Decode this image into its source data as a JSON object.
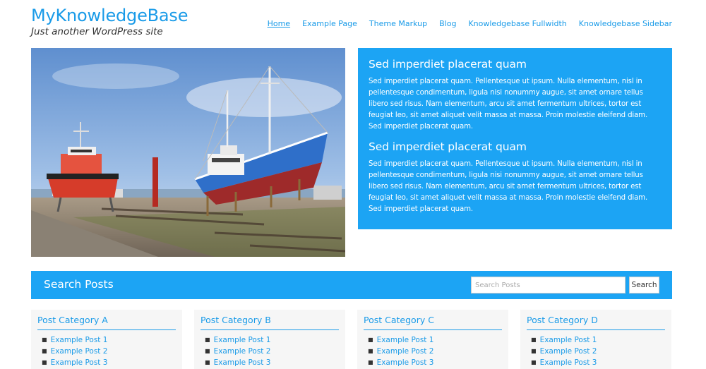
{
  "header": {
    "site_title": "MyKnowledgeBase",
    "tagline": "Just another WordPress site"
  },
  "nav": {
    "items": [
      {
        "label": "Home",
        "active": true
      },
      {
        "label": "Example Page"
      },
      {
        "label": "Theme Markup"
      },
      {
        "label": "Blog"
      },
      {
        "label": "Knowledgebase Fullwidth"
      },
      {
        "label": "Knowledgebase Sidebar"
      }
    ]
  },
  "hero": {
    "image_icon": "boats-photo"
  },
  "info": {
    "sections": [
      {
        "heading": "Sed imperdiet placerat quam",
        "body": "Sed imperdiet placerat quam. Pellentesque ut ipsum. Nulla elementum, nisl in pellentesque condimentum, ligula nisi nonummy augue, sit amet ornare tellus libero sed risus. Nam elementum, arcu sit amet fermentum ultrices, tortor est feugiat leo, sit amet aliquet velit massa at massa. Proin molestie eleifend diam. Sed imperdiet placerat quam."
      },
      {
        "heading": "Sed imperdiet placerat quam",
        "body": "Sed imperdiet placerat quam. Pellentesque ut ipsum. Nulla elementum, nisl in pellentesque condimentum, ligula nisi nonummy augue, sit amet ornare tellus libero sed risus. Nam elementum, arcu sit amet fermentum ultrices, tortor est feugiat leo, sit amet aliquet velit massa at massa. Proin molestie eleifend diam. Sed imperdiet placerat quam."
      }
    ]
  },
  "search": {
    "title": "Search Posts",
    "placeholder": "Search Posts",
    "button_label": "Search"
  },
  "categories": [
    {
      "title": "Post Category A",
      "posts": [
        "Example Post 1",
        "Example Post 2",
        "Example Post 3"
      ]
    },
    {
      "title": "Post Category B",
      "posts": [
        "Example Post 1",
        "Example Post 2",
        "Example Post 3"
      ]
    },
    {
      "title": "Post Category C",
      "posts": [
        "Example Post 1",
        "Example Post 2",
        "Example Post 3"
      ]
    },
    {
      "title": "Post Category D",
      "posts": [
        "Example Post 1",
        "Example Post 2",
        "Example Post 3"
      ]
    }
  ],
  "colors": {
    "accent": "#1a9be8",
    "panel_blue": "#1ca4f4",
    "card_bg": "#f6f6f6"
  }
}
